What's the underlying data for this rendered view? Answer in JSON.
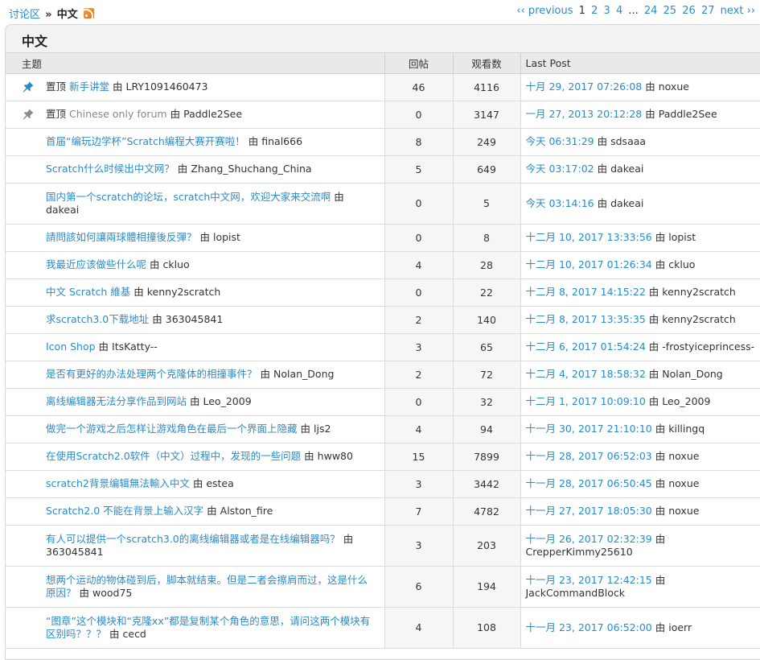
{
  "breadcrumb": {
    "root": "讨论区",
    "sep": "»",
    "current": "中文"
  },
  "pagination": {
    "prev": "‹‹ previous",
    "current": "1",
    "pages": [
      "2",
      "3",
      "4"
    ],
    "ellipsis": "...",
    "tail": [
      "24",
      "25",
      "26",
      "27"
    ],
    "next": "next ››"
  },
  "panel_title": "中文",
  "headers": {
    "topic": "主题",
    "replies": "回帖",
    "views": "观看数",
    "last_post": "Last Post"
  },
  "by_label": "由",
  "sticky_label": "置顶",
  "topics": [
    {
      "sticky": true,
      "pin": "blue",
      "title": "新手讲堂",
      "author": "LRY1091460473",
      "replies": "46",
      "views": "4116",
      "last_date": "十月 29, 2017 07:26:08",
      "last_author": "noxue"
    },
    {
      "sticky": true,
      "pin": "gray",
      "title": "Chinese only forum",
      "author": "Paddle2See",
      "replies": "0",
      "views": "3147",
      "last_date": "一月 27, 2013 20:12:28",
      "last_author": "Paddle2See"
    },
    {
      "title": "首届“编玩边学杯”Scratch编程大赛开赛啦！",
      "author": "final666",
      "replies": "8",
      "views": "249",
      "last_date": "今天 06:31:29",
      "last_author": "sdsaaa"
    },
    {
      "title": "Scratch什么时候出中文网？",
      "author": "Zhang_Shuchang_China",
      "replies": "5",
      "views": "649",
      "last_date": "今天 03:17:02",
      "last_author": "dakeai"
    },
    {
      "title": "国内第一个scratch的论坛，scratch中文网，欢迎大家来交流啊",
      "author": "dakeai",
      "replies": "0",
      "views": "5",
      "last_date": "今天 03:14:16",
      "last_author": "dakeai",
      "tall": true
    },
    {
      "title": "請問該如何讓兩球體相撞後反彈？",
      "author": "lopist",
      "replies": "0",
      "views": "8",
      "last_date": "十二月 10, 2017 13:33:56",
      "last_author": "lopist"
    },
    {
      "title": "我最近应该做些什么呢",
      "author": "ckluo",
      "replies": "4",
      "views": "28",
      "last_date": "十二月 10, 2017 01:26:34",
      "last_author": "ckluo"
    },
    {
      "title": "中文 Scratch 維基",
      "author": "kenny2scratch",
      "replies": "0",
      "views": "22",
      "last_date": "十二月 8, 2017 14:15:22",
      "last_author": "kenny2scratch"
    },
    {
      "title": "求scratch3.0下载地址",
      "author": "363045841",
      "replies": "2",
      "views": "140",
      "last_date": "十二月 8, 2017 13:35:35",
      "last_author": "kenny2scratch"
    },
    {
      "title": "Icon Shop",
      "author": "ItsKatty--",
      "replies": "3",
      "views": "65",
      "last_date": "十二月 6, 2017 01:54:24",
      "last_author": "-frostyiceprincess-"
    },
    {
      "title": "是否有更好的办法处理两个克隆体的相撞事件？",
      "author": "Nolan_Dong",
      "replies": "2",
      "views": "72",
      "last_date": "十二月 4, 2017 18:58:32",
      "last_author": "Nolan_Dong"
    },
    {
      "title": "离线编辑器无法分享作品到网站",
      "author": "Leo_2009",
      "replies": "0",
      "views": "32",
      "last_date": "十二月 1, 2017 10:09:10",
      "last_author": "Leo_2009"
    },
    {
      "title": "做完一个游戏之后怎样让游戏角色在最后一个界面上隐藏",
      "author": "ljs2",
      "replies": "4",
      "views": "94",
      "last_date": "十一月 30, 2017 21:10:10",
      "last_author": "killingq"
    },
    {
      "title": "在使用Scratch2.0软件（中文）过程中，发现的一些问题",
      "author": "hww80",
      "replies": "15",
      "views": "7899",
      "last_date": "十一月 28, 2017 06:52:03",
      "last_author": "noxue"
    },
    {
      "title": "scratch2背景编辑無法輸入中文",
      "author": "estea",
      "replies": "3",
      "views": "3442",
      "last_date": "十一月 28, 2017 06:50:45",
      "last_author": "noxue"
    },
    {
      "title": "Scratch2.0 不能在背景上输入汉字",
      "author": "Alston_fire",
      "replies": "7",
      "views": "4782",
      "last_date": "十一月 27, 2017 18:05:30",
      "last_author": "noxue"
    },
    {
      "title": "有人可以提供一个scratch3.0的离线编辑器或者是在线编辑器吗？",
      "author": "363045841",
      "replies": "3",
      "views": "203",
      "last_date": "十一月 26, 2017 02:32:39",
      "last_author": "CrepperKimmy25610",
      "tall": true
    },
    {
      "title": "想两个运动的物体碰到后，脚本就结束。但是二者会擦肩而过，这是什么原因？",
      "author": "wood75",
      "replies": "6",
      "views": "194",
      "last_date": "十一月 23, 2017 12:42:15",
      "last_author": "JackCommandBlock",
      "tall": true
    },
    {
      "title": "“图章”这个模块和“克隆xx”都是复制某个角色的意思，请问这两个模块有区别吗？？？",
      "author": "cecd",
      "replies": "4",
      "views": "108",
      "last_date": "十一月 23, 2017 06:52:00",
      "last_author": "ioerr",
      "tall": true
    }
  ]
}
